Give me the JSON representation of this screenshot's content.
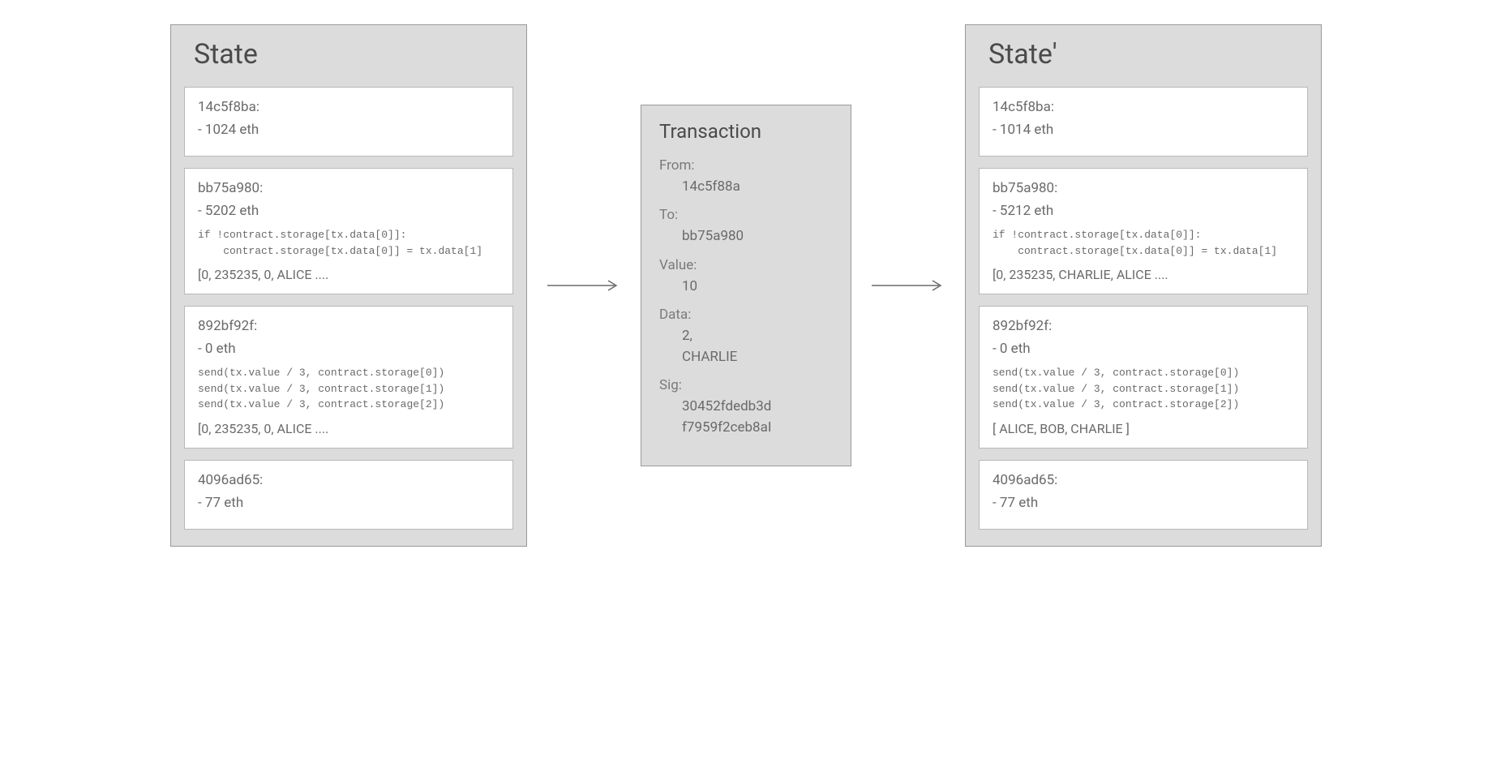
{
  "state": {
    "title": "State",
    "accounts": [
      {
        "addr": "14c5f8ba:",
        "balance": "- 1024 eth",
        "code": "",
        "storage": ""
      },
      {
        "addr": "bb75a980:",
        "balance": "- 5202 eth",
        "code": "if !contract.storage[tx.data[0]]:\n    contract.storage[tx.data[0]] = tx.data[1]",
        "storage": "[0, 235235, 0, ALICE ...."
      },
      {
        "addr": "892bf92f:",
        "balance": "- 0 eth",
        "code": "send(tx.value / 3, contract.storage[0])\nsend(tx.value / 3, contract.storage[1])\nsend(tx.value / 3, contract.storage[2])",
        "storage": "[0, 235235, 0, ALICE ...."
      },
      {
        "addr": "4096ad65:",
        "balance": "- 77 eth",
        "code": "",
        "storage": ""
      }
    ]
  },
  "transaction": {
    "title": "Transaction",
    "fields": {
      "from_label": "From:",
      "from_value": "14c5f88a",
      "to_label": "To:",
      "to_value": "bb75a980",
      "value_label": "Value:",
      "value_value": "10",
      "data_label": "Data:",
      "data_value": "2,\nCHARLIE",
      "sig_label": "Sig:",
      "sig_value": "30452fdedb3d\nf7959f2ceb8aI"
    }
  },
  "state_prime": {
    "title": "State'",
    "accounts": [
      {
        "addr": "14c5f8ba:",
        "balance": "- 1014 eth",
        "code": "",
        "storage": ""
      },
      {
        "addr": "bb75a980:",
        "balance": "- 5212 eth",
        "code": "if !contract.storage[tx.data[0]]:\n    contract.storage[tx.data[0]] = tx.data[1]",
        "storage": "[0, 235235, CHARLIE, ALICE ...."
      },
      {
        "addr": "892bf92f:",
        "balance": "- 0 eth",
        "code": "send(tx.value / 3, contract.storage[0])\nsend(tx.value / 3, contract.storage[1])\nsend(tx.value / 3, contract.storage[2])",
        "storage": "[ ALICE, BOB, CHARLIE ]"
      },
      {
        "addr": "4096ad65:",
        "balance": "- 77 eth",
        "code": "",
        "storage": ""
      }
    ]
  }
}
